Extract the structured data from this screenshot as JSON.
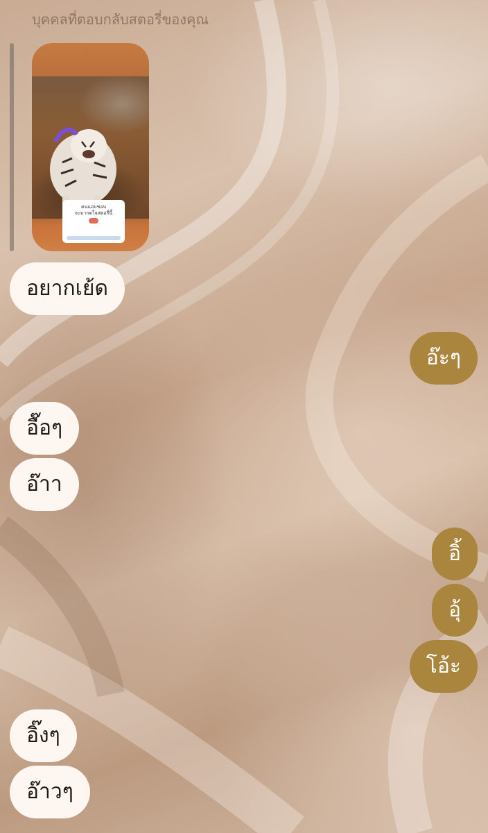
{
  "header": {
    "label": "บุคคลที่ตอบกลับสตอรี่ของคุณ"
  },
  "story": {
    "sticker_line1": "คนแอบชอบ",
    "sticker_line2": "จะมากดใจสตอรี่นี้"
  },
  "messages": [
    {
      "side": "in",
      "text": "อยากเย้ด"
    },
    {
      "side": "out",
      "text": "อ๊ะๆ"
    },
    {
      "side": "in",
      "text": "อื๊อๆ"
    },
    {
      "side": "in",
      "text": "อ๊าา"
    },
    {
      "side": "out",
      "text": "อิ้"
    },
    {
      "side": "out",
      "text": "อุ้"
    },
    {
      "side": "out",
      "text": "โอ้ะ"
    },
    {
      "side": "in",
      "text": "อิ๊งๆ"
    },
    {
      "side": "in",
      "text": "อ๊าวๆ"
    }
  ],
  "colors": {
    "incoming_bubble": "#fdf6f1",
    "outgoing_bubble": "#a9853e",
    "background": "#d2b8a2"
  }
}
